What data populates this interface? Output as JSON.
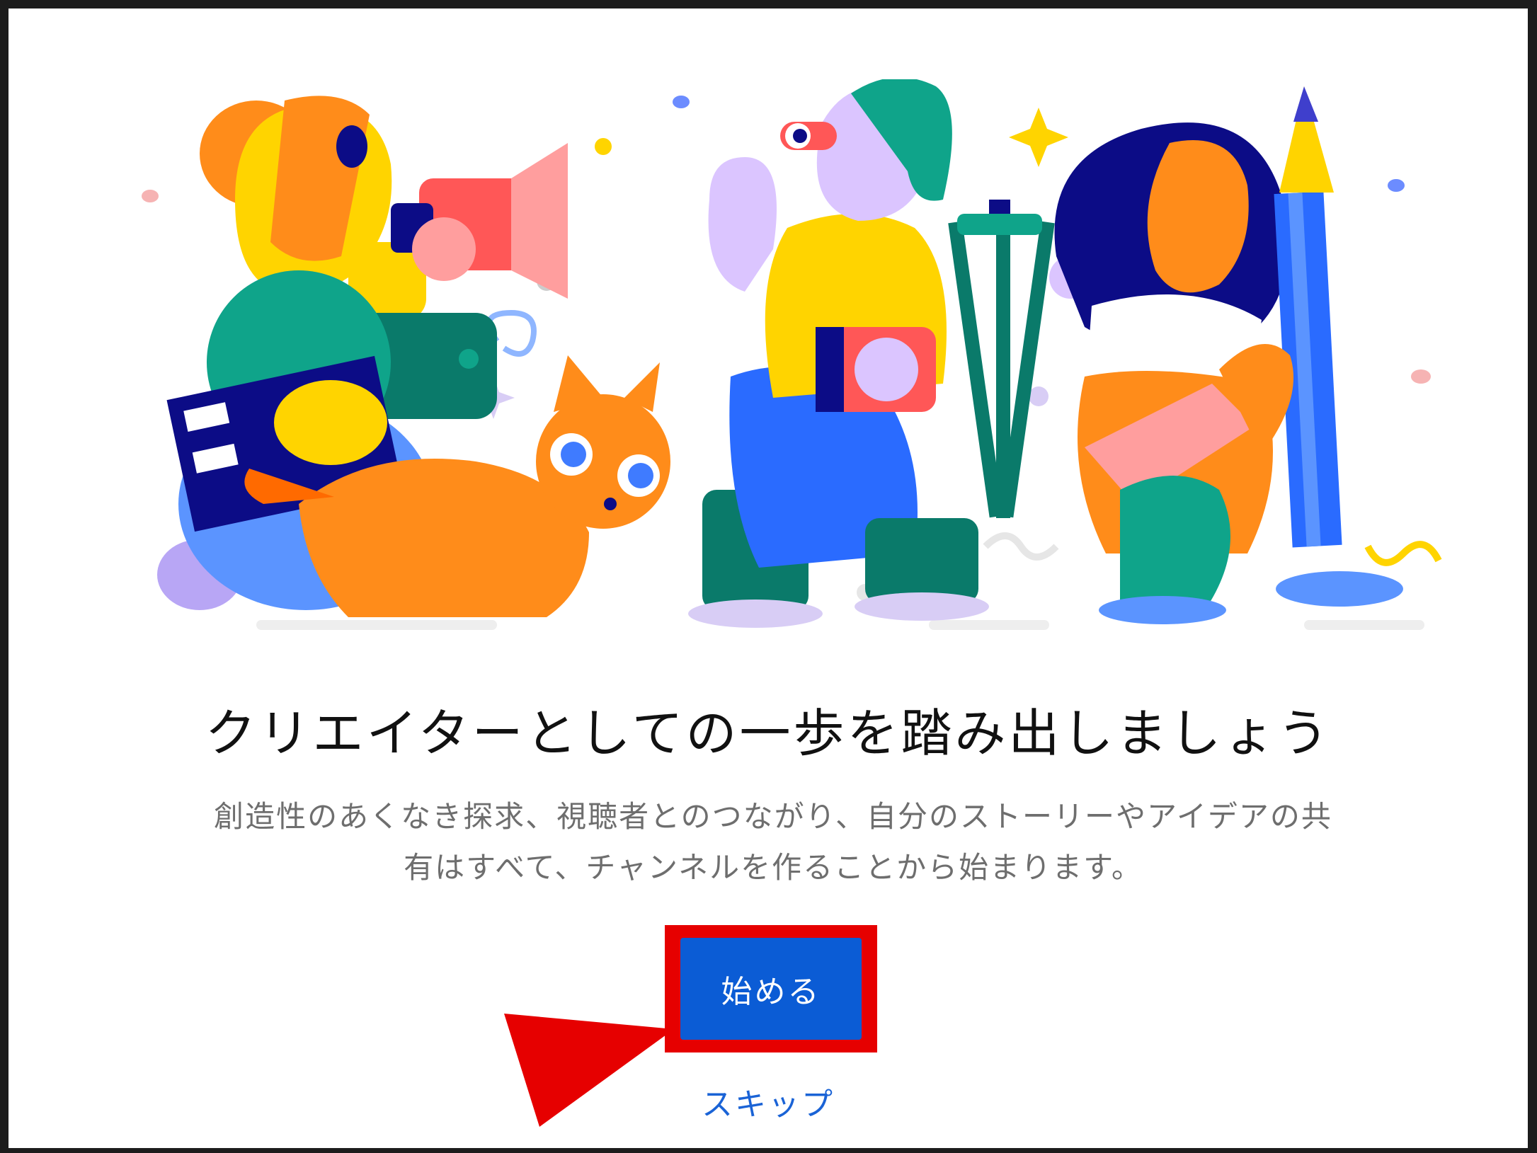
{
  "dialog": {
    "title": "クリエイターとしての一歩を踏み出しましょう",
    "description_line1": "創造性のあくなき探求、視聴者とのつながり、自分のストーリーやアイデアの共",
    "description_line2": "有はすべて、チャンネルを作ることから始まります。",
    "start_button_label": "始める",
    "skip_link_label": "スキップ"
  },
  "colors": {
    "primary_button": "#0b5cd5",
    "link": "#1a63d6",
    "annotation_red": "#e60000"
  },
  "icons": [
    "creators-illustration",
    "annotation-arrow-icon"
  ]
}
